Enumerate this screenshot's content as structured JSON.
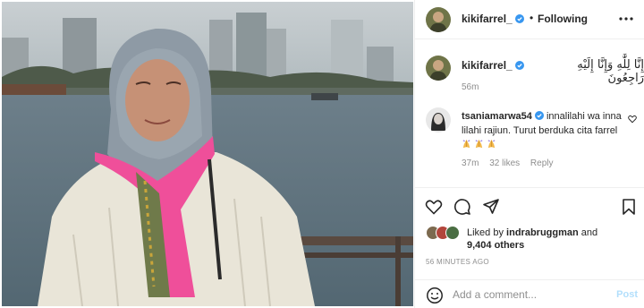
{
  "header": {
    "username": "kikifarrel_",
    "separator": "•",
    "follow_status": "Following",
    "more_icon": "more-horizontal-icon"
  },
  "caption": {
    "username": "kikifarrel_",
    "text": "إِنَّا لِلَّٰهِ وَإِنَّا إِلَيْهِ رَاجِعُونَ",
    "time": "56m"
  },
  "comment": {
    "username": "tsaniamarwa54",
    "text": "innalilahi wa inna lilahi rajiun. Turut berduka cita farrel",
    "emoji_count": 3,
    "time": "37m",
    "likes": "32 likes",
    "reply": "Reply"
  },
  "likes": {
    "prefix": "Liked by",
    "user": "indrabruggman",
    "and": "and",
    "others": "9,404 others"
  },
  "posted": "56 MINUTES AGO",
  "add_comment": {
    "placeholder": "Add a comment...",
    "post_label": "Post"
  },
  "colors": {
    "verified": "#3897f0",
    "muted": "#8e8e8e",
    "post_disabled": "#b2dffc"
  }
}
